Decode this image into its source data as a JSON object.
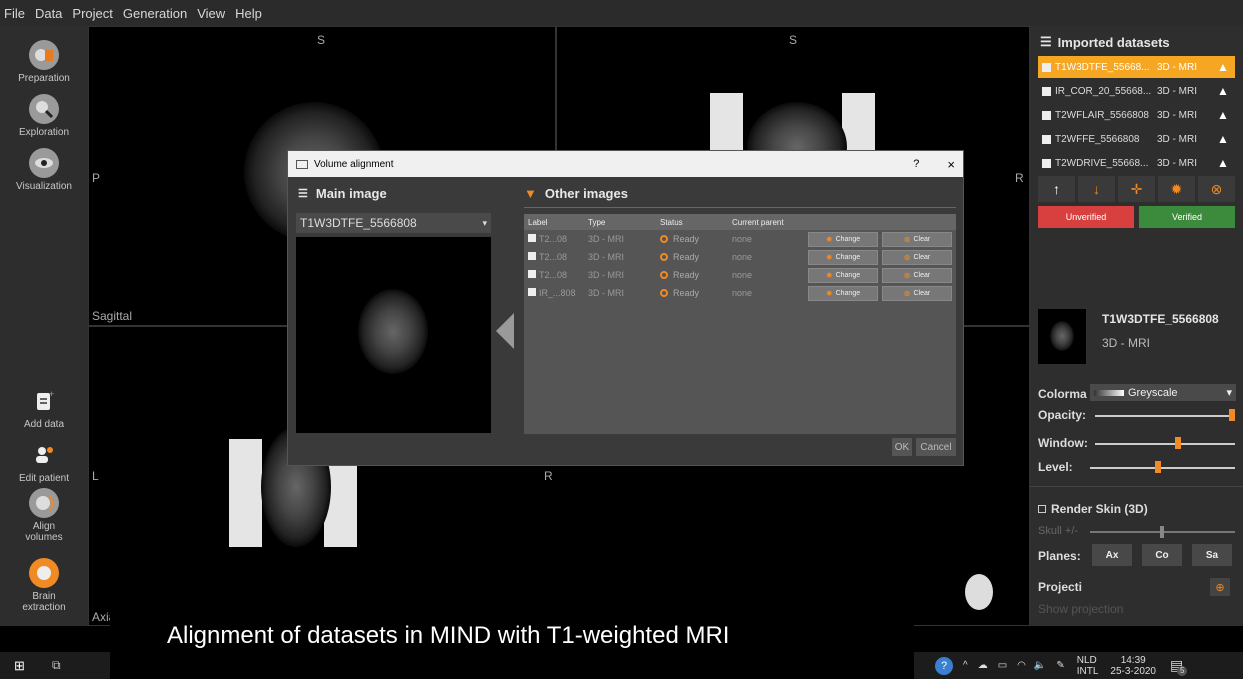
{
  "menu": [
    "File",
    "Data",
    "Project",
    "Generation",
    "View",
    "Help"
  ],
  "left_toolbar": {
    "top": [
      {
        "label": "Preparation",
        "icon": "preparation-icon"
      },
      {
        "label": "Exploration",
        "icon": "exploration-icon"
      },
      {
        "label": "Visualization",
        "icon": "visualization-icon"
      }
    ],
    "bottom": [
      {
        "label": "Add data",
        "icon": "add-data-icon"
      },
      {
        "label": "Edit patient",
        "icon": "edit-patient-icon"
      },
      {
        "label": "Align volumes",
        "icon": "align-volumes-icon"
      },
      {
        "label": "Brain extraction",
        "icon": "brain-extraction-icon"
      }
    ]
  },
  "viewports": {
    "sagittal": {
      "top": "S",
      "left": "P",
      "name": "Sagittal"
    },
    "coronal": {
      "top": "S",
      "right": "R"
    },
    "axial": {
      "left": "L",
      "right": "R",
      "name": "Axial"
    }
  },
  "dialog": {
    "title": "Volume alignment",
    "help": "?",
    "close": "×",
    "main_image_title": "Main image",
    "main_image_value": "T1W3DTFE_5566808",
    "other_images_title": "Other images",
    "columns": [
      "Label",
      "Type",
      "Status",
      "Current parent"
    ],
    "rows": [
      {
        "label": "T2...08",
        "type": "3D - MRI",
        "status": "Ready",
        "parent": "none",
        "change": "Change",
        "clear": "Clear"
      },
      {
        "label": "T2...08",
        "type": "3D - MRI",
        "status": "Ready",
        "parent": "none",
        "change": "Change",
        "clear": "Clear"
      },
      {
        "label": "T2...08",
        "type": "3D - MRI",
        "status": "Ready",
        "parent": "none",
        "change": "Change",
        "clear": "Clear"
      },
      {
        "label": "IR_...808",
        "type": "3D - MRI",
        "status": "Ready",
        "parent": "none",
        "change": "Change",
        "clear": "Clear"
      }
    ],
    "ok": "OK",
    "cancel": "Cancel"
  },
  "right_panel": {
    "title": "Imported datasets",
    "datasets": [
      {
        "name": "T1W3DTFE_55668...",
        "type": "3D - MRI",
        "selected": true
      },
      {
        "name": "IR_COR_20_55668...",
        "type": "3D - MRI",
        "selected": false
      },
      {
        "name": "T2WFLAIR_5566808",
        "type": "3D - MRI",
        "selected": false
      },
      {
        "name": "T2WFFE_5566808",
        "type": "3D - MRI",
        "selected": false
      },
      {
        "name": "T2WDRIVE_55668...",
        "type": "3D - MRI",
        "selected": false
      }
    ],
    "unverified": "Unverified",
    "verified": "Verified",
    "selected_name": "T1W3DTFE_5566808",
    "selected_type": "3D - MRI",
    "colormap_label": "Colorma",
    "colormap_value": "Greyscale",
    "opacity_label": "Opacity:",
    "window_label": "Window:",
    "level_label": "Level:",
    "render_skin": "Render Skin (3D)",
    "skull_label": "Skull +/-",
    "planes_label": "Planes:",
    "planes": [
      "Ax",
      "Co",
      "Sa"
    ],
    "projection_label": "Projecti",
    "show_projection": "Show projection",
    "opacity": 1.0,
    "window": 0.6,
    "level": 0.47,
    "skull": 0.5
  },
  "caption": "Alignment of datasets in MIND with T1-weighted MRI",
  "taskbar": {
    "lang1": "NLD",
    "lang2": "INTL",
    "time": "14:39",
    "date": "25-3-2020",
    "notifications": "5"
  },
  "colors": {
    "accent": "#f08a24",
    "selected_dataset": "#f5a623",
    "unverified": "#d84040",
    "verified": "#3c8a3c"
  }
}
